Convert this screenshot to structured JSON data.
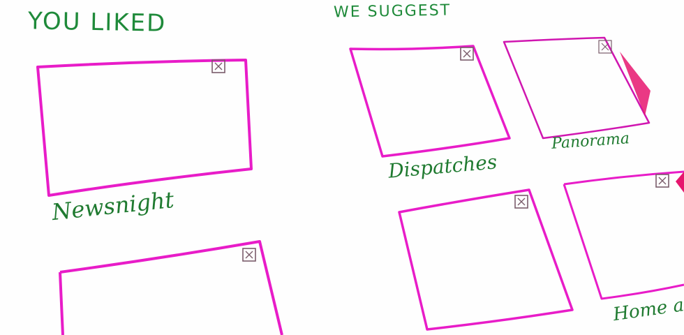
{
  "liked": {
    "heading": "YOU LIKED",
    "items": [
      {
        "caption": "Newsnight"
      },
      {
        "caption": ""
      }
    ]
  },
  "suggested": {
    "heading": "WE SUGGEST",
    "items": [
      {
        "caption": "Dispatches"
      },
      {
        "caption": "Panorama"
      },
      {
        "caption": ""
      },
      {
        "caption": "Home an"
      }
    ]
  },
  "colors": {
    "frame": "#e81cc8",
    "frame_faded": "#d016b0",
    "text": "#1f7a30",
    "close_icon": "#7a5c6a",
    "arrow": "#e6166e"
  },
  "close_icon_glyph": "x"
}
